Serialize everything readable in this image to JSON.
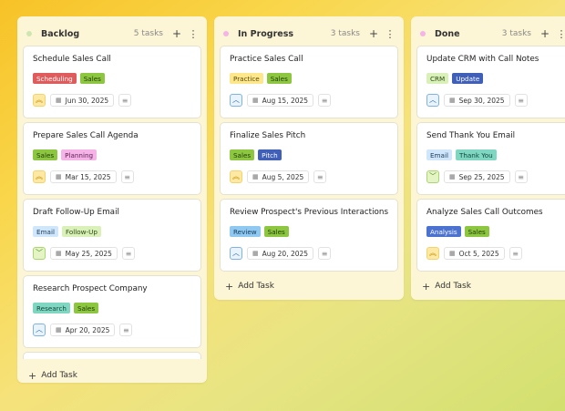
{
  "colors": {
    "scheduling": "#e05c5c",
    "sales": "#8dc63f",
    "planning": "#f5b3e8",
    "email": "#cfe6fb",
    "followup": "#d9f0b8",
    "research": "#7fd6c1",
    "practice": "#fde78a",
    "pitch": "#3f5fb8",
    "review": "#8fc8f0",
    "crm": "#d9f0b8",
    "update": "#3f5fb8",
    "thankyou": "#7fd6c1",
    "analysis": "#4b72d1"
  },
  "columns": [
    {
      "title": "Backlog",
      "count": "5 tasks",
      "dot": "#cfe6b0",
      "add_label": "Add Task",
      "cards": [
        {
          "title": "Schedule Sales Call",
          "tags": [
            {
              "label": "Scheduling",
              "bg": "#e05c5c",
              "fg": "#ffffff"
            },
            {
              "label": "Sales",
              "bg": "#8dc63f",
              "fg": "#1e3a10"
            }
          ],
          "priority": "high",
          "date": "Jun 30, 2025"
        },
        {
          "title": "Prepare Sales Call Agenda",
          "tags": [
            {
              "label": "Sales",
              "bg": "#8dc63f",
              "fg": "#1e3a10"
            },
            {
              "label": "Planning",
              "bg": "#f5b3e8",
              "fg": "#5a1e50"
            }
          ],
          "priority": "high",
          "date": "Mar 15, 2025"
        },
        {
          "title": "Draft Follow-Up Email",
          "tags": [
            {
              "label": "Email",
              "bg": "#cfe6fb",
              "fg": "#1a3a5c"
            },
            {
              "label": "Follow-Up",
              "bg": "#d9f0b8",
              "fg": "#2e4a16"
            }
          ],
          "priority": "low",
          "date": "May 25, 2025"
        },
        {
          "title": "Research Prospect Company",
          "tags": [
            {
              "label": "Research",
              "bg": "#7fd6c1",
              "fg": "#114a3c"
            },
            {
              "label": "Sales",
              "bg": "#8dc63f",
              "fg": "#1e3a10"
            }
          ],
          "priority": "medium",
          "date": "Apr 20, 2025"
        }
      ]
    },
    {
      "title": "In Progress",
      "count": "3 tasks",
      "dot": "#f5b3e8",
      "add_label": "Add Task",
      "cards": [
        {
          "title": "Practice Sales Call",
          "tags": [
            {
              "label": "Practice",
              "bg": "#fde78a",
              "fg": "#5a4a10"
            },
            {
              "label": "Sales",
              "bg": "#8dc63f",
              "fg": "#1e3a10"
            }
          ],
          "priority": "medium",
          "date": "Aug 15, 2025"
        },
        {
          "title": "Finalize Sales Pitch",
          "tags": [
            {
              "label": "Sales",
              "bg": "#8dc63f",
              "fg": "#1e3a10"
            },
            {
              "label": "Pitch",
              "bg": "#3f5fb8",
              "fg": "#ffffff"
            }
          ],
          "priority": "high",
          "date": "Aug 5, 2025"
        },
        {
          "title": "Review Prospect's Previous Interactions",
          "tags": [
            {
              "label": "Review",
              "bg": "#8fc8f0",
              "fg": "#163a5c"
            },
            {
              "label": "Sales",
              "bg": "#8dc63f",
              "fg": "#1e3a10"
            }
          ],
          "priority": "medium",
          "date": "Aug 20, 2025"
        }
      ]
    },
    {
      "title": "Done",
      "count": "3 tasks",
      "dot": "#f5b3e8",
      "add_label": "Add Task",
      "cards": [
        {
          "title": "Update CRM with Call Notes",
          "tags": [
            {
              "label": "CRM",
              "bg": "#d9f0b8",
              "fg": "#2e4a16"
            },
            {
              "label": "Update",
              "bg": "#3f5fb8",
              "fg": "#ffffff"
            }
          ],
          "priority": "medium",
          "date": "Sep 30, 2025"
        },
        {
          "title": "Send Thank You Email",
          "tags": [
            {
              "label": "Email",
              "bg": "#cfe6fb",
              "fg": "#1a3a5c"
            },
            {
              "label": "Thank You",
              "bg": "#7fd6c1",
              "fg": "#114a3c"
            }
          ],
          "priority": "low",
          "date": "Sep 25, 2025"
        },
        {
          "title": "Analyze Sales Call Outcomes",
          "tags": [
            {
              "label": "Analysis",
              "bg": "#4b72d1",
              "fg": "#ffffff"
            },
            {
              "label": "Sales",
              "bg": "#8dc63f",
              "fg": "#1e3a10"
            }
          ],
          "priority": "high",
          "date": "Oct 5, 2025"
        }
      ]
    }
  ]
}
